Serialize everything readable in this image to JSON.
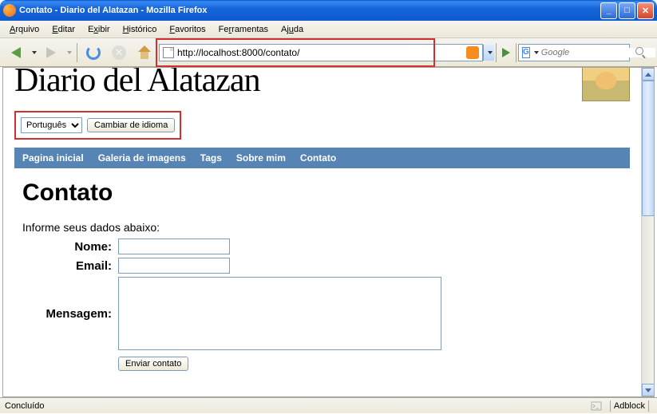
{
  "window": {
    "title": "Contato - Diario del Alatazan - Mozilla Firefox"
  },
  "menubar": {
    "arquivo": "Arquivo",
    "editar": "Editar",
    "exibir": "Exibir",
    "historico": "Histórico",
    "favoritos": "Favoritos",
    "ferramentas": "Ferramentas",
    "ajuda": "Ajuda"
  },
  "toolbar": {
    "url": "http://localhost:8000/contato/",
    "search_placeholder": "Google"
  },
  "page": {
    "site_title": "Diario del Alatazan",
    "lang_selected": "Português",
    "lang_button": "Cambiar de idioma",
    "nav": {
      "home": "Pagina inicial",
      "gallery": "Galeria de imagens",
      "tags": "Tags",
      "about": "Sobre mim",
      "contact": "Contato"
    },
    "heading": "Contato",
    "intro": "Informe seus dados abaixo:",
    "form": {
      "nome_label": "Nome:",
      "email_label": "Email:",
      "mensagem_label": "Mensagem:",
      "submit": "Enviar contato"
    }
  },
  "statusbar": {
    "text": "Concluído",
    "adblock": "Adblock"
  }
}
